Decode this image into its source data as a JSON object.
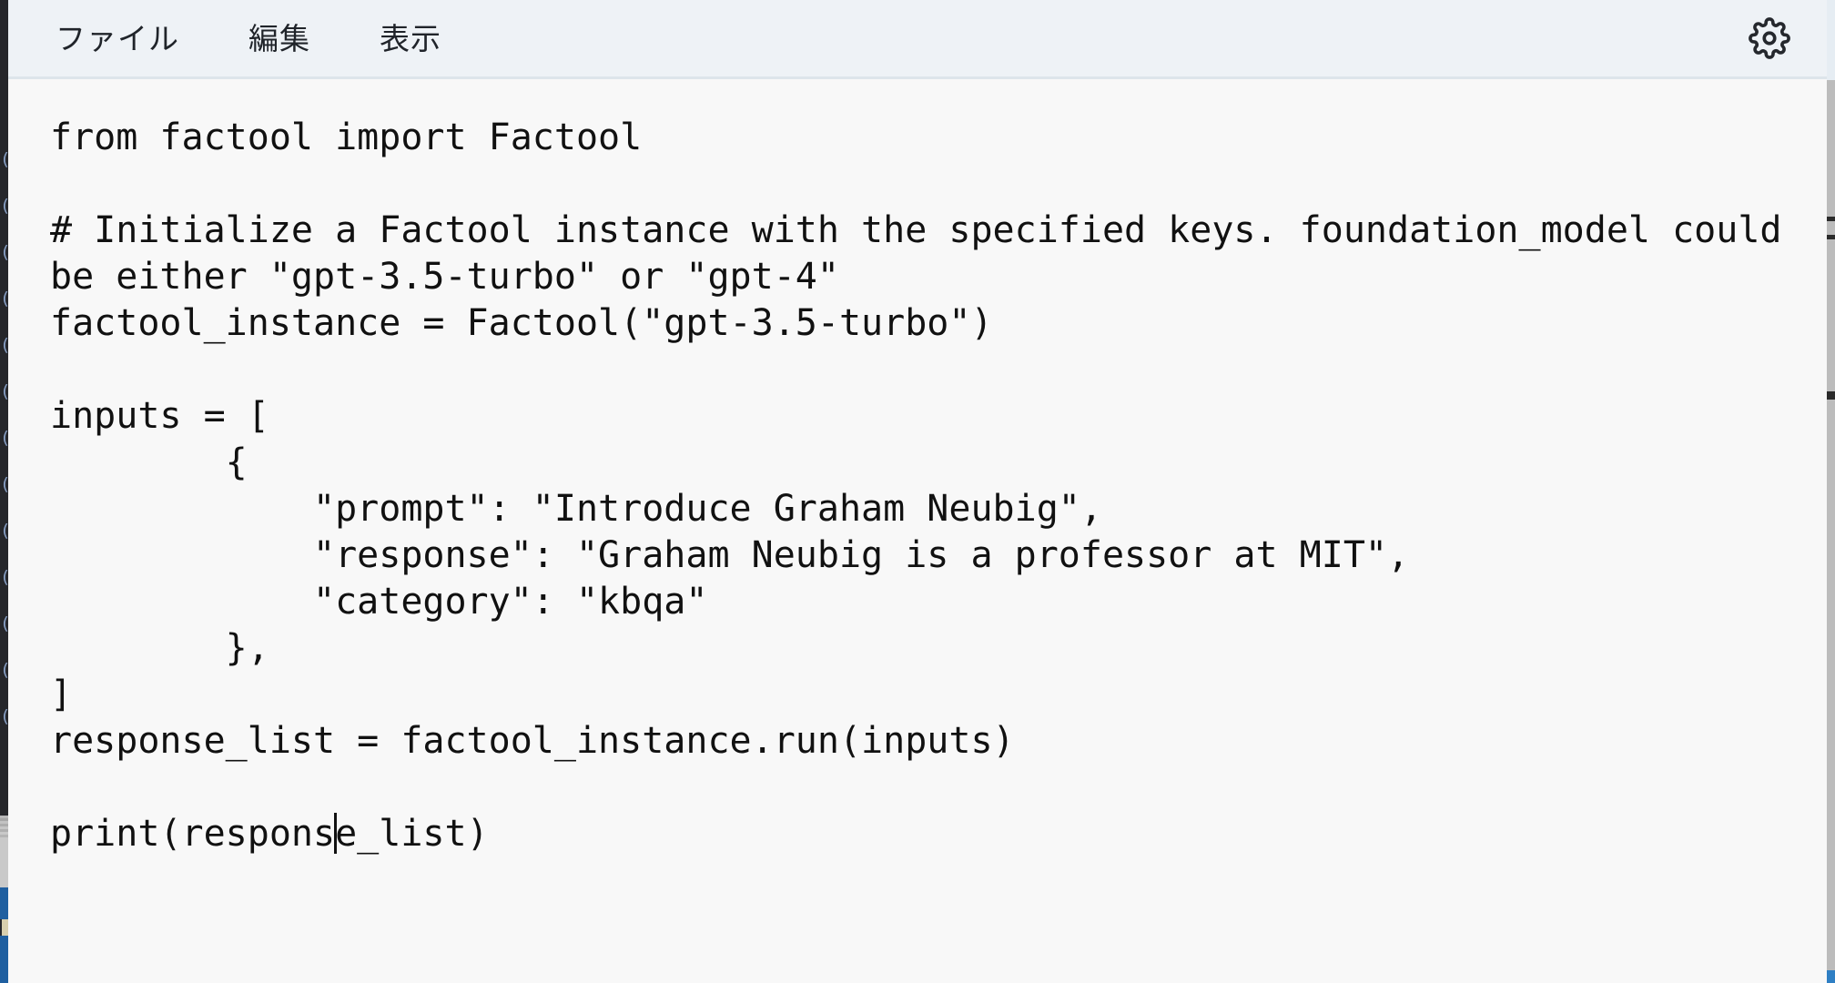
{
  "window": {
    "title": "Text Editor",
    "background_color": "#f8f8f8"
  },
  "menubar": {
    "background_color": "#eef2f6",
    "items": [
      {
        "label": "ファイル",
        "name": "file"
      },
      {
        "label": "編集",
        "name": "edit"
      },
      {
        "label": "表示",
        "name": "view"
      }
    ],
    "settings_icon": "gear-icon"
  },
  "editor": {
    "background_color": "#f8f8f8",
    "text_color": "#111111",
    "caret": {
      "line_index": 15,
      "column": 15,
      "color": "#111111"
    },
    "lines": [
      {
        "text": "from factool import Factool"
      },
      {
        "text": ""
      },
      {
        "text": "# Initialize a Factool instance with the specified keys. foundation_model could"
      },
      {
        "text": "be either \"gpt-3.5-turbo\" or \"gpt-4\""
      },
      {
        "text": "factool_instance = Factool(\"gpt-3.5-turbo\")"
      },
      {
        "text": ""
      },
      {
        "text": "inputs = ["
      },
      {
        "text": "        {"
      },
      {
        "text": "            \"prompt\": \"Introduce Graham Neubig\","
      },
      {
        "text": "            \"response\": \"Graham Neubig is a professor at MIT\","
      },
      {
        "text": "            \"category\": \"kbqa\""
      },
      {
        "text": "        },"
      },
      {
        "text": "]"
      },
      {
        "text": "response_list = factool_instance.run(inputs)"
      },
      {
        "text": ""
      },
      {
        "text": "print(response_list)",
        "caret_after": "print(respons"
      }
    ]
  },
  "edges": {
    "left_strip_color": "#26272b",
    "left_strip_gray_color": "#c0c0c0",
    "left_strip_blue_color": "#1f5fa0",
    "right_strip_color": "#bcbcbc",
    "ghost_glyphs": "(\n(\n(\n(\n(\n(\n(\n(\n(\n(\n(\n(\n("
  }
}
